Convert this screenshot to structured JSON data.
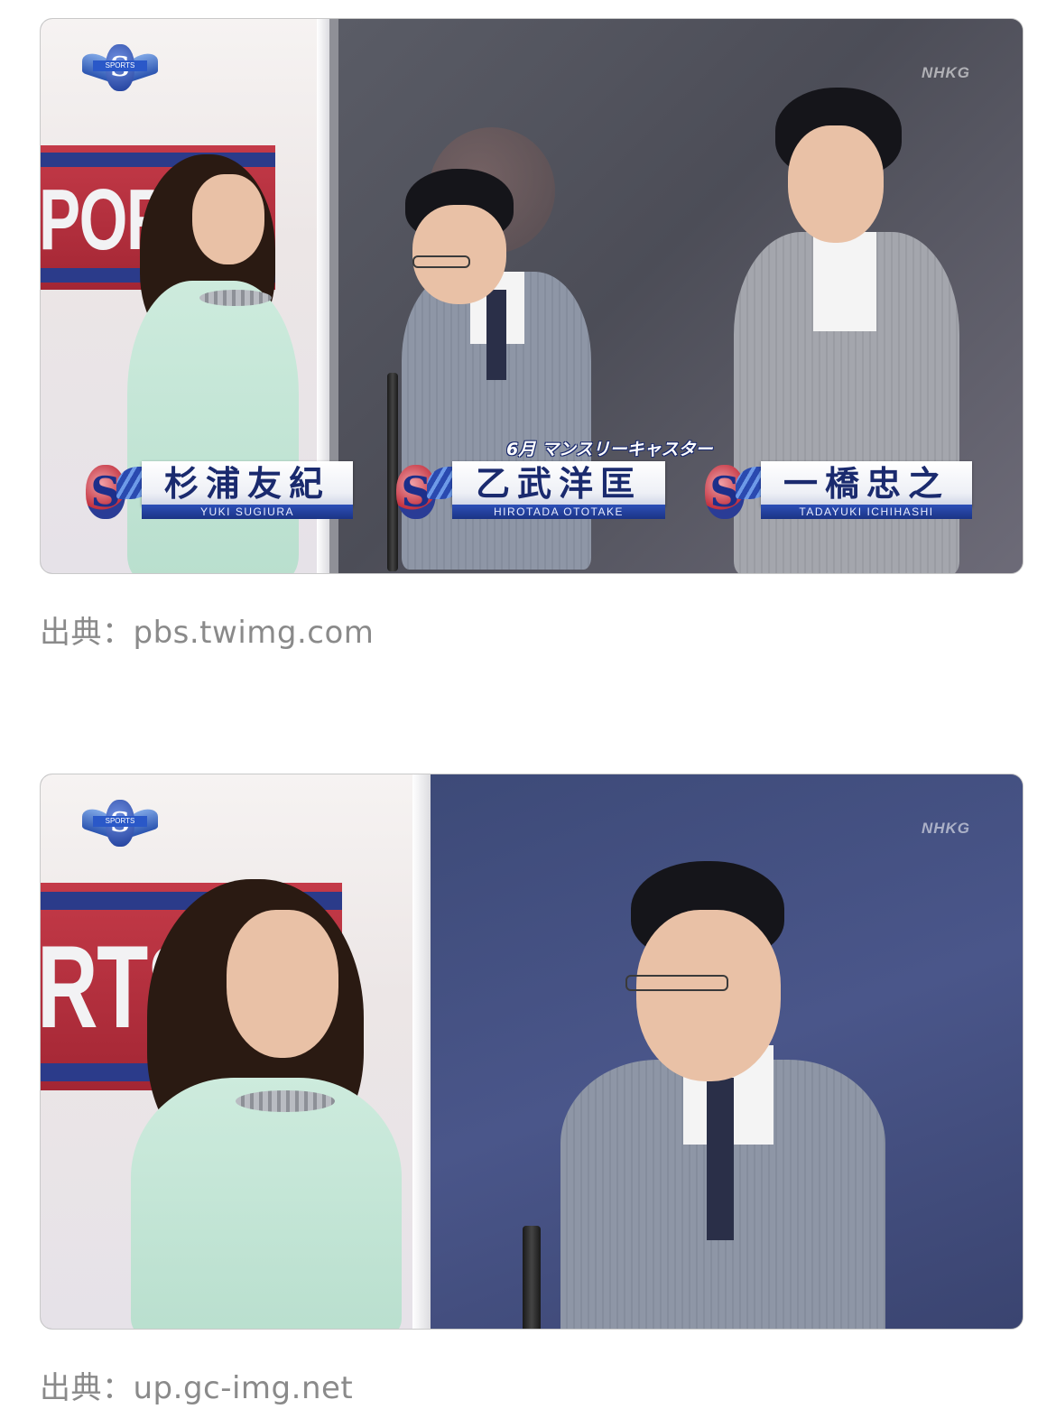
{
  "photos": [
    {
      "watermark": "NHKG",
      "emblem_text": "SPORTS",
      "backdrop_text": "PORTS",
      "caption_label": "6月 マンスリーキャスター",
      "name_plates": [
        {
          "name": "杉浦友紀",
          "roman": "YUKI SUGIURA"
        },
        {
          "name": "乙武洋匡",
          "roman": "HIROTADA OTOTAKE"
        },
        {
          "name": "一橋忠之",
          "roman": "TADAYUKI ICHIHASHI"
        }
      ],
      "source": "出典：pbs.twimg.com"
    },
    {
      "watermark": "NHKG",
      "emblem_text": "SPORTS",
      "backdrop_text": "RTS",
      "source": "出典：up.gc-img.net"
    }
  ],
  "colors": {
    "caption_text": "#8a8a8a",
    "plate_name": "#1a2a6e",
    "plate_roman_bar": "#2d4fb8",
    "sports_red": "#c43a48"
  }
}
